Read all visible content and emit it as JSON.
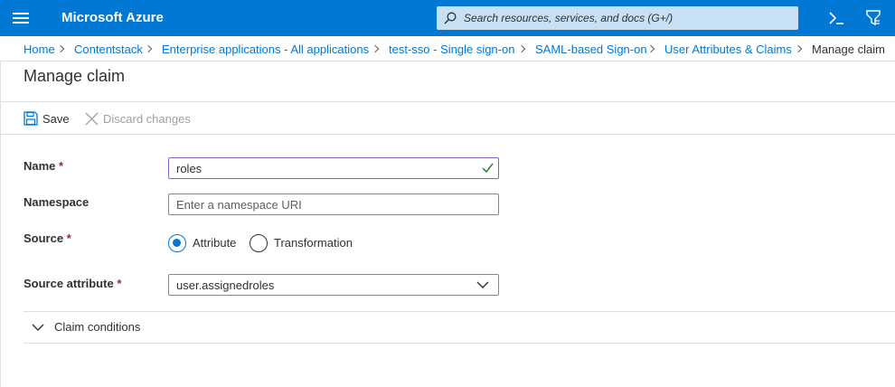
{
  "header": {
    "brand": "Microsoft Azure",
    "search_placeholder": "Search resources, services, and docs (G+/)"
  },
  "breadcrumb": [
    "Home",
    "Contentstack",
    "Enterprise applications - All applications",
    "test-sso - Single sign-on",
    "SAML-based Sign-on",
    "User Attributes & Claims",
    "Manage claim"
  ],
  "page": {
    "title": "Manage claim"
  },
  "toolbar": {
    "save_label": "Save",
    "discard_label": "Discard changes"
  },
  "form": {
    "name_label": "Name",
    "name_value": "roles",
    "namespace_label": "Namespace",
    "namespace_placeholder": "Enter a namespace URI",
    "source_label": "Source",
    "source_options": [
      "Attribute",
      "Transformation"
    ],
    "source_selected": "Attribute",
    "source_attribute_label": "Source attribute",
    "source_attribute_value": "user.assignedroles",
    "required_marker": "*"
  },
  "claim_conditions": {
    "label": "Claim conditions",
    "expanded": false
  },
  "colors": {
    "azure_blue": "#0078d4",
    "focus_border": "#8661c5",
    "success_check": "#107c10",
    "required": "#a4262c"
  }
}
